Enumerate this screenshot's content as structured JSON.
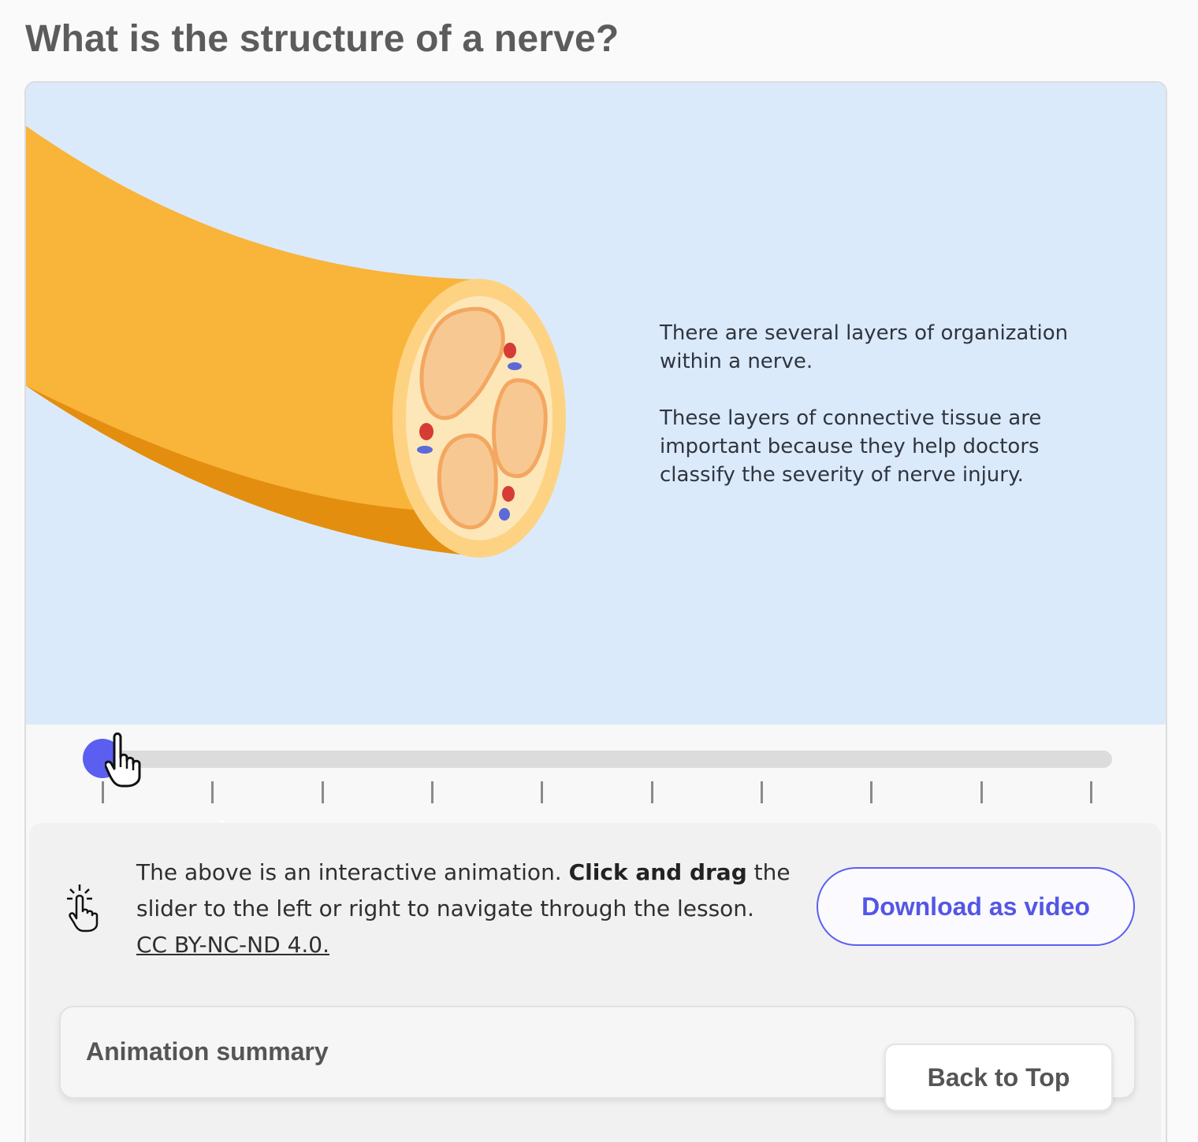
{
  "page": {
    "title": "What is the structure of a nerve?"
  },
  "animation": {
    "paragraphs": [
      "There are several layers of organization within a nerve.",
      "These layers of connective tissue are important because they help doctors classify the severity of nerve injury."
    ],
    "slider": {
      "position": 0,
      "steps": 10
    }
  },
  "info": {
    "text_before": "The above is an interactive animation. ",
    "text_bold": "Click and drag",
    "text_after": " the slider to the left or right to navigate through the lesson. ",
    "license_link": "CC BY-NC-ND 4.0."
  },
  "buttons": {
    "download": "Download as video",
    "back_to_top": "Back to Top"
  },
  "summary": {
    "title": "Animation summary"
  },
  "colors": {
    "accent": "#5b5ff0",
    "stage_background": "#dbeafa",
    "nerve_orange": "#f9b43a",
    "nerve_dark_orange": "#e38e0f"
  },
  "icons": {
    "slider_cursor": "hand-pointer-icon",
    "info_icon": "tap-gesture-icon"
  }
}
